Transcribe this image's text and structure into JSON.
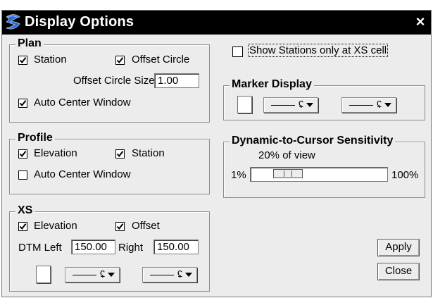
{
  "window": {
    "title": "Display Options",
    "close_label": "×"
  },
  "plan": {
    "label": "Plan",
    "station_label": "Station",
    "station_checked": true,
    "offset_circle_label": "Offset Circle",
    "offset_circle_checked": true,
    "offset_circle_size_label": "Offset Circle Size",
    "offset_circle_size_value": "1.00",
    "auto_center_label": "Auto Center Window",
    "auto_center_checked": true
  },
  "profile": {
    "label": "Profile",
    "elevation_label": "Elevation",
    "elevation_checked": true,
    "station_label": "Station",
    "station_checked": true,
    "auto_center_label": "Auto Center Window",
    "auto_center_checked": false
  },
  "xs": {
    "label": "XS",
    "elevation_label": "Elevation",
    "elevation_checked": true,
    "offset_label": "Offset",
    "offset_checked": true,
    "dtm_left_label": "DTM Left",
    "dtm_left_value": "150.00",
    "right_label": "Right",
    "right_value": "150.00",
    "weight_glyph": "ʢ"
  },
  "show_stations": {
    "label": "Show Stations only at XS cell",
    "checked": false
  },
  "marker_display": {
    "label": "Marker Display",
    "weight_glyph": "ʢ"
  },
  "sensitivity": {
    "label": "Dynamic-to-Cursor Sensitivity",
    "value_text": "20% of view",
    "min_label": "1%",
    "max_label": "100%",
    "value_fraction": 0.2
  },
  "buttons": {
    "apply": "Apply",
    "close": "Close"
  }
}
